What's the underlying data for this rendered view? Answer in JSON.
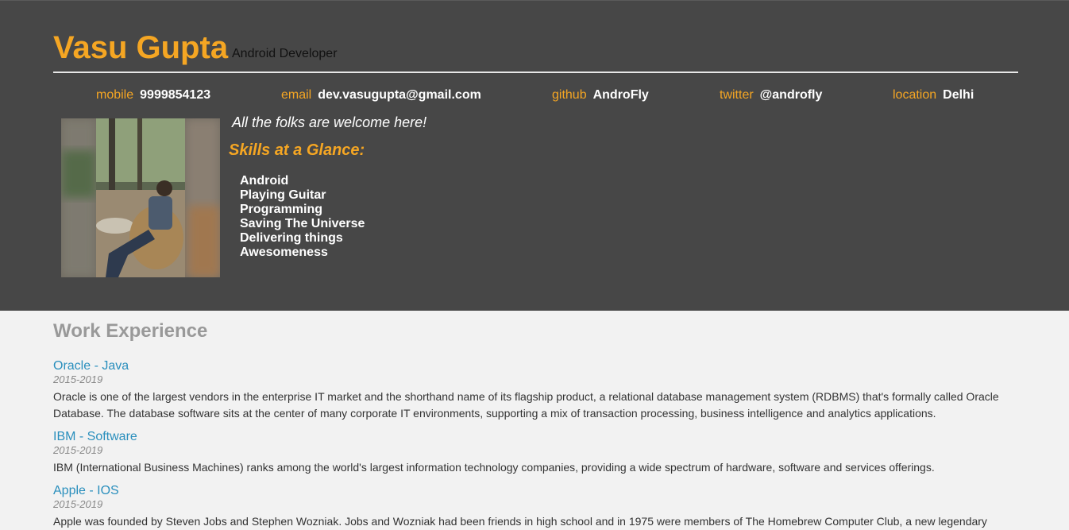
{
  "header": {
    "name": "Vasu Gupta",
    "role": "Android Developer",
    "tagline": "All the folks are welcome here!",
    "skills_title": "Skills at a Glance:",
    "skills": [
      "Android",
      "Playing Guitar",
      "Programming",
      "Saving The Universe",
      "Delivering things",
      "Awesomeness"
    ]
  },
  "contacts": [
    {
      "key": "mobile",
      "value": "9999854123"
    },
    {
      "key": "email",
      "value": "dev.vasugupta@gmail.com"
    },
    {
      "key": "github",
      "value": "AndroFly"
    },
    {
      "key": "twitter",
      "value": "@androfly"
    },
    {
      "key": "location",
      "value": "Delhi"
    }
  ],
  "work": {
    "title": "Work Experience",
    "jobs": [
      {
        "title": "Oracle - Java",
        "years": "2015-2019",
        "desc": "Oracle is one of the largest vendors in the enterprise IT market and the shorthand name of its flagship product, a relational database management system (RDBMS) that's formally called Oracle Database. The database software sits at the center of many corporate IT environments, supporting a mix of transaction processing, business intelligence and analytics applications."
      },
      {
        "title": "IBM - Software",
        "years": "2015-2019",
        "desc": "IBM (International Business Machines) ranks among the world's largest information technology companies, providing a wide spectrum of hardware, software and services offerings."
      },
      {
        "title": "Apple - IOS",
        "years": "2015-2019",
        "desc": "Apple was founded by Steven Jobs and Stephen Wozniak. Jobs and Wozniak had been friends in high school and in 1975 were members of The Homebrew Computer Club, a new legendary"
      }
    ]
  },
  "colors": {
    "header_bg": "#474747",
    "accent": "#f5a623",
    "link": "#2a8fbd",
    "page_bg": "#f2f2f2"
  }
}
